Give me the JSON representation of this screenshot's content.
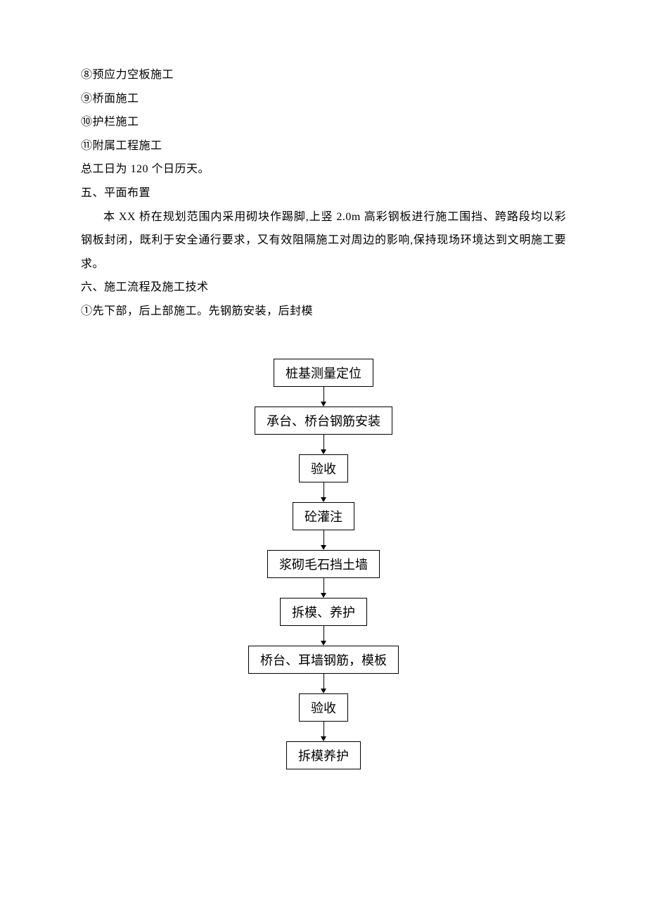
{
  "body": {
    "items": [
      "⑧预应力空板施工",
      "⑨桥面施工",
      "⑩护栏施工",
      "⑪附属工程施工",
      "总工日为 120 个日历天。"
    ],
    "section5_title": "五、平面布置",
    "section5_para": "本 XX 桥在规划范围内采用砌块作踢脚,上竖 2.0m 高彩钢板进行施工围挡、跨路段均以彩钢板封闭，既利于安全通行要求，又有效阻隔施工对周边的影响,保持现场环境达到文明施工要求。",
    "section6_title": "六、施工流程及施工技术",
    "section6_sub": "①先下部，后上部施工。先钢筋安装，后封模"
  },
  "flow": {
    "steps": [
      "桩基测量定位",
      "承台、桥台钢筋安装",
      "验收",
      "砼灌注",
      "浆砌毛石挡土墙",
      "拆模、养护",
      "桥台、耳墙钢筋，模板",
      "验收",
      "拆模养护"
    ]
  },
  "chart_data": {
    "type": "flowchart",
    "direction": "top-down",
    "nodes": [
      {
        "id": 1,
        "label": "桩基测量定位"
      },
      {
        "id": 2,
        "label": "承台、桥台钢筋安装"
      },
      {
        "id": 3,
        "label": "验收"
      },
      {
        "id": 4,
        "label": "砼灌注"
      },
      {
        "id": 5,
        "label": "浆砌毛石挡土墙"
      },
      {
        "id": 6,
        "label": "拆模、养护"
      },
      {
        "id": 7,
        "label": "桥台、耳墙钢筋，模板"
      },
      {
        "id": 8,
        "label": "验收"
      },
      {
        "id": 9,
        "label": "拆模养护"
      }
    ],
    "edges": [
      {
        "from": 1,
        "to": 2
      },
      {
        "from": 2,
        "to": 3
      },
      {
        "from": 3,
        "to": 4
      },
      {
        "from": 4,
        "to": 5
      },
      {
        "from": 5,
        "to": 6
      },
      {
        "from": 6,
        "to": 7
      },
      {
        "from": 7,
        "to": 8
      },
      {
        "from": 8,
        "to": 9
      }
    ]
  }
}
